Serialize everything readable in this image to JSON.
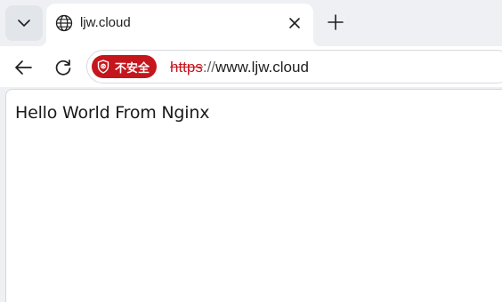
{
  "tabs": [
    {
      "title": "ljw.cloud",
      "icon": "globe-icon",
      "active": true
    }
  ],
  "tabstrip": {
    "menu_icon": "chevron-down-icon",
    "new_tab_icon": "plus-icon",
    "close_icon": "close-icon"
  },
  "toolbar": {
    "back_icon": "arrow-left-icon",
    "reload_icon": "reload-icon",
    "security_label": "不安全",
    "security_icon": "shield-alert-icon",
    "security_color": "#c5161d",
    "url_scheme": "https",
    "url_separator": "://",
    "url_host": "www.ljw.cloud"
  },
  "page": {
    "body_text": "Hello World From Nginx"
  }
}
